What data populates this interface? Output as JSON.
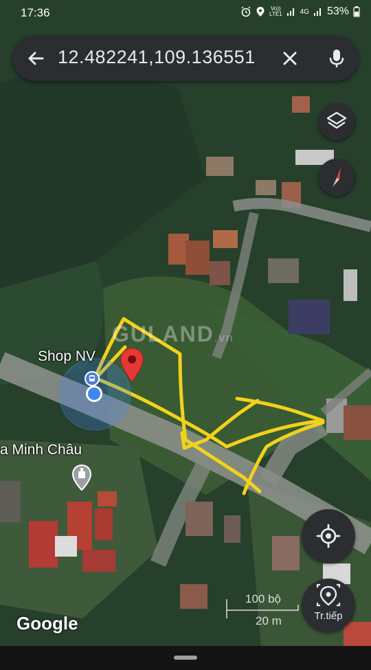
{
  "status_bar": {
    "time": "17:36",
    "volte_line1": "Vo))",
    "volte_line2": "LTE1",
    "network": "4G",
    "battery": "53%"
  },
  "search": {
    "query": "12.482241,109.136551"
  },
  "map": {
    "place_labels": {
      "shop": "Shop NV",
      "church": "a Minh Châu"
    },
    "watermark": "GULAND",
    "watermark_suffix": ".vn",
    "attribution": "Google",
    "scale": {
      "imperial": "100 bộ",
      "metric": "20 m"
    },
    "colors": {
      "drawing": "#f2d21a",
      "pin": "#e53935",
      "location": "#4285f4"
    }
  },
  "controls": {
    "navigate_label": "Tr.tiếp"
  },
  "icons": [
    "back-arrow-icon",
    "close-icon",
    "mic-icon",
    "layers-icon",
    "compass-icon",
    "my-location-icon",
    "directions-icon",
    "church-icon",
    "map-pin-icon",
    "bus-stop-icon"
  ]
}
